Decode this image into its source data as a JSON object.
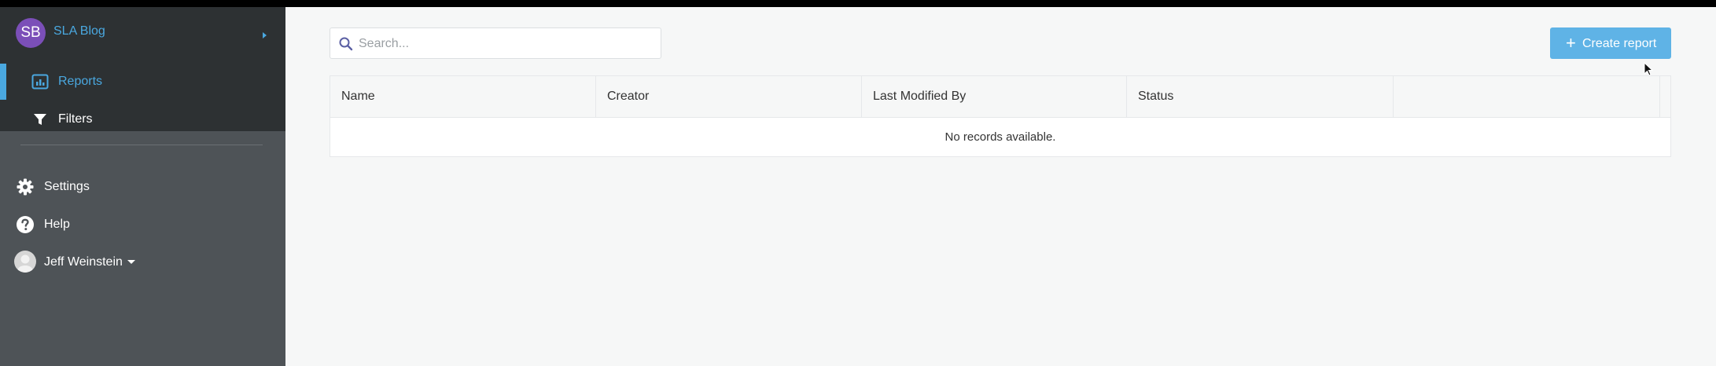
{
  "workspace": {
    "initials": "SB",
    "name": "SLA Blog"
  },
  "nav": {
    "items": [
      {
        "label": "Reports",
        "icon": "reports-icon",
        "active": true
      },
      {
        "label": "Filters",
        "icon": "filter-icon",
        "active": false
      }
    ]
  },
  "lower_nav": {
    "settings": "Settings",
    "help": "Help",
    "user": "Jeff Weinstein"
  },
  "search": {
    "placeholder": "Search..."
  },
  "toolbar": {
    "create_label": "Create report"
  },
  "table": {
    "columns": [
      "Name",
      "Creator",
      "Last Modified By",
      "Status",
      ""
    ],
    "empty_message": "No records available."
  },
  "colors": {
    "accent": "#4aa8e0",
    "button": "#5fb3e6",
    "sidebar_dark": "#2d3133",
    "sidebar": "#4e5357",
    "avatar": "#7b4fb8"
  }
}
